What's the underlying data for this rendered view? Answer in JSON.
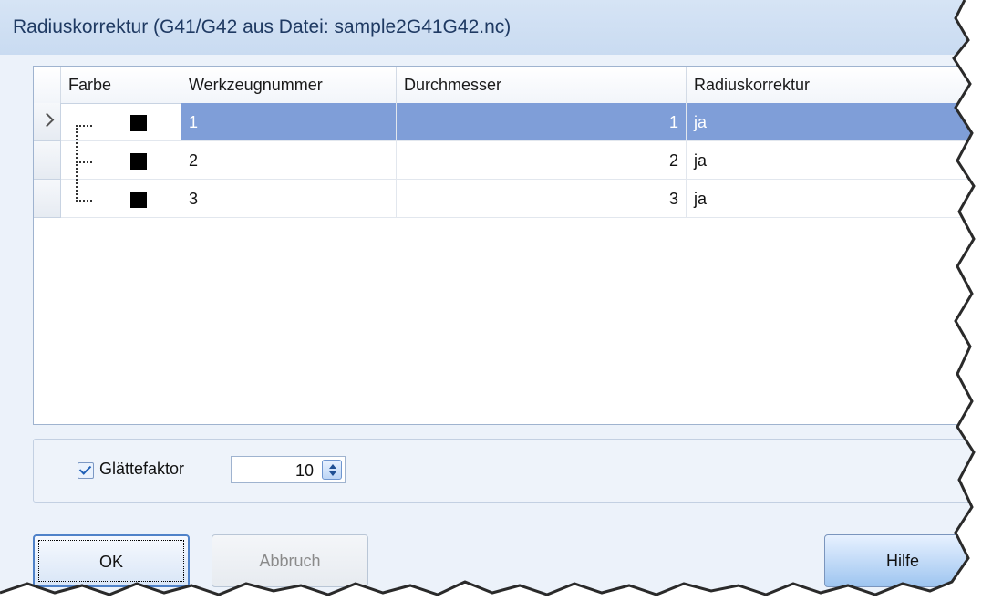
{
  "window": {
    "title": "Radiuskorrektur (G41/G42 aus Datei: sample2G41G42.nc)"
  },
  "grid": {
    "columns": [
      "Farbe",
      "Werkzeugnummer",
      "Durchmesser",
      "Radiuskorrektur"
    ],
    "rows": [
      {
        "color": "#000000",
        "tool": "1",
        "diameter": "1",
        "correction": "ja",
        "selected": true
      },
      {
        "color": "#000000",
        "tool": "2",
        "diameter": "2",
        "correction": "ja",
        "selected": false
      },
      {
        "color": "#000000",
        "tool": "3",
        "diameter": "3",
        "correction": "ja",
        "selected": false
      }
    ]
  },
  "smoothing": {
    "checked": true,
    "label": "Glättefaktor",
    "value": "10"
  },
  "buttons": {
    "ok": "OK",
    "cancel": "Abbruch",
    "help": "Hilfe"
  },
  "colors": {
    "selection": "#7f9ed8",
    "titlebar": "#c9dbf1"
  }
}
